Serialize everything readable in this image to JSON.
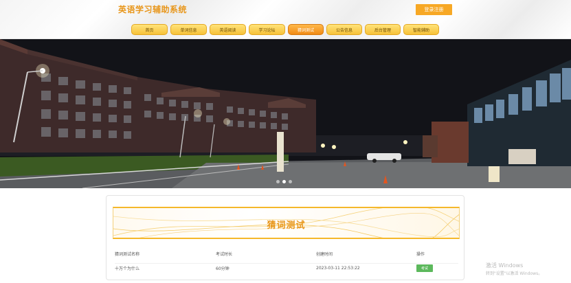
{
  "header": {
    "app_title": "英语学习辅助系统",
    "login_button": "登录注册"
  },
  "nav": {
    "items": [
      {
        "label": "首页"
      },
      {
        "label": "单词信息"
      },
      {
        "label": "英语阅读"
      },
      {
        "label": "学习论坛"
      },
      {
        "label": "猜词测试"
      },
      {
        "label": "公告信息"
      },
      {
        "label": "后台管理"
      },
      {
        "label": "智能辅助"
      }
    ],
    "active_index": 4
  },
  "banner": {
    "slide_count": 3,
    "active_slide": 2
  },
  "section": {
    "title": "猜词测试",
    "columns": [
      "猜词测试名称",
      "考试时长",
      "创建时间",
      "操作"
    ],
    "rows": [
      {
        "name": "十万个为什么",
        "duration": "60分钟",
        "created": "2023-03-11 22:53:22",
        "action": "考试"
      }
    ]
  },
  "watermark": {
    "line1": "激活 Windows",
    "line2": "转到\"设置\"以激活 Windows。"
  },
  "colors": {
    "accent": "#f7a825",
    "title_text": "#e8961a",
    "exam_button": "#5cb85c"
  }
}
